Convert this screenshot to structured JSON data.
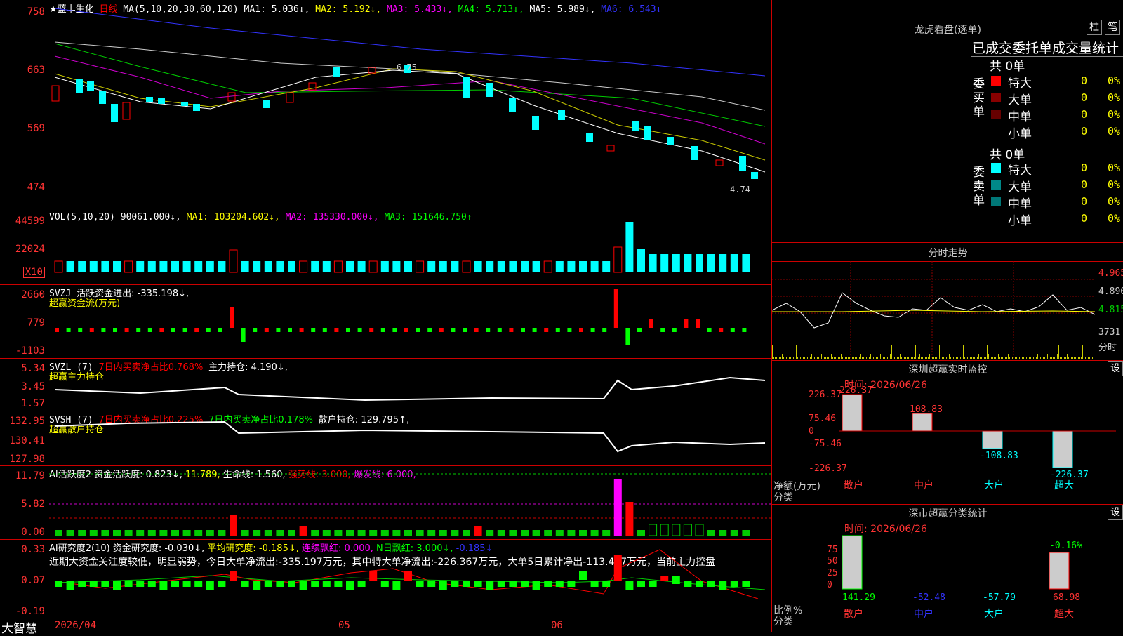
{
  "app": {
    "brand": "大智慧"
  },
  "stock": {
    "name": "★蓝丰生化",
    "period": "日线"
  },
  "main": {
    "ma_header": {
      "lbl": "MA(5,10,20,30,60,120)",
      "ma1": "MA1: 5.036↓,",
      "ma2": "MA2: 5.192↓,",
      "ma3": "MA3: 5.433↓,",
      "ma4": "MA4: 5.713↓,",
      "ma5": "MA5: 5.989↓,",
      "ma6": "MA6: 6.543↓"
    },
    "axis": [
      "758",
      "663",
      "569",
      "474"
    ],
    "high_label": "6.75",
    "low_label": "4.74"
  },
  "vol": {
    "lbl": "VOL(5,10,20)",
    "val": "90061.000↓,",
    "ma1": "MA1: 103204.602↓,",
    "ma2": "MA2: 135330.000↓,",
    "ma3": "MA3: 151646.750↑",
    "axis": [
      "44599",
      "22024"
    ],
    "mult": "X10"
  },
  "svzj": {
    "lbl": "SVZJ",
    "t1": "活跃资金进出: -335.198↓,",
    "sub": "超赢资金流(万元)",
    "axis": [
      "2660",
      "779",
      "-1103"
    ]
  },
  "svzl": {
    "lbl": "SVZL (7)",
    "t1": "7日内买卖净占比0.768%",
    "t2": "主力持仓: 4.190↓,",
    "sub": "超赢主力持仓",
    "axis": [
      "5.34",
      "3.45",
      "1.57"
    ]
  },
  "svsh": {
    "lbl": "SVSH (7)",
    "t1": "7日内买卖净占比0.225%",
    "t2": "7日内买卖净占比0.178%",
    "t3": "散户持仓: 129.795↑,",
    "sub": "超赢散户持仓",
    "axis": [
      "132.95",
      "130.41",
      "127.98"
    ]
  },
  "ai1": {
    "lbl": "AI活跃度2",
    "t1": "资金活跃度: 0.823↓,",
    "t2": "11.789,",
    "t3": "生命线: 1.560,",
    "t4": "强势线: 3.000,",
    "t5": "爆发线: 6.000,",
    "axis": [
      "11.79",
      "5.82",
      "0.00"
    ]
  },
  "ai2": {
    "lbl": "AI研究度2(10)",
    "t1": "资金研究度: -0.030↓,",
    "t2": "平均研究度: -0.185↓,",
    "t3": "连续飘红: 0.000,",
    "t4": "N日飘红: 3.000↓,",
    "t5": "-0.185↓",
    "desc": "近期大资金关注度较低，明显弱势，今日大单净流出:-335.197万元，其中特大单净流出:-226.367万元，大单5日累计净出-113.437万元，当前主力控盘",
    "axis": [
      "0.33",
      "0.07",
      "-0.19"
    ]
  },
  "dates": [
    "2026/04",
    "05",
    "06"
  ],
  "right": {
    "lh_title": "龙虎看盘(逐单)",
    "btn1": "柱",
    "btn2": "笔",
    "stats_title": "已成交委托单成交量统计",
    "buy": {
      "side": "委买单",
      "total": "共 0单",
      "rows": [
        {
          "name": "特大",
          "v": "0",
          "p": "0%",
          "color": "#f00"
        },
        {
          "name": "大单",
          "v": "0",
          "p": "0%",
          "color": "#800"
        },
        {
          "name": "中单",
          "v": "0",
          "p": "0%",
          "color": "#600"
        },
        {
          "name": "小单",
          "v": "0",
          "p": "0%",
          "color": ""
        }
      ]
    },
    "sell": {
      "side": "委卖单",
      "total": "共 0单",
      "rows": [
        {
          "name": "特大",
          "v": "0",
          "p": "0%",
          "color": "#0ff"
        },
        {
          "name": "大单",
          "v": "0",
          "p": "0%",
          "color": "#088"
        },
        {
          "name": "中单",
          "v": "0",
          "p": "0%",
          "color": "#077"
        },
        {
          "name": "小单",
          "v": "0",
          "p": "0%",
          "color": ""
        }
      ]
    },
    "ts_title": "分时走势",
    "ts_axis": [
      "4.965",
      "4.890",
      "4.815"
    ],
    "ts_vol": "3731",
    "ts_tag": "分时",
    "sz_title": "深圳超赢实时监控",
    "sz_btn": "设",
    "sz_time": "时间: 2026/06/26",
    "sz_axis": [
      "226.37",
      "75.46",
      "0",
      "-75.46",
      "-226.37"
    ],
    "sz_ylab": "净额(万元)",
    "sz_xlab": "分类",
    "sz_cats": [
      "散户",
      "中户",
      "大户",
      "超大"
    ],
    "sz_vals": [
      "226.37",
      "108.83",
      "-108.83",
      "-226.37"
    ],
    "cls_title": "深市超赢分类统计",
    "cls_btn": "设",
    "cls_time": "时间: 2026/06/26",
    "cls_axis": [
      "75",
      "50",
      "25",
      "0"
    ],
    "cls_ylab": "比例%",
    "cls_xlab": "分类",
    "cls_top": "-0.16%",
    "cls_vals": [
      "141.29",
      "-52.48",
      "-57.79",
      "68.98"
    ]
  }
}
